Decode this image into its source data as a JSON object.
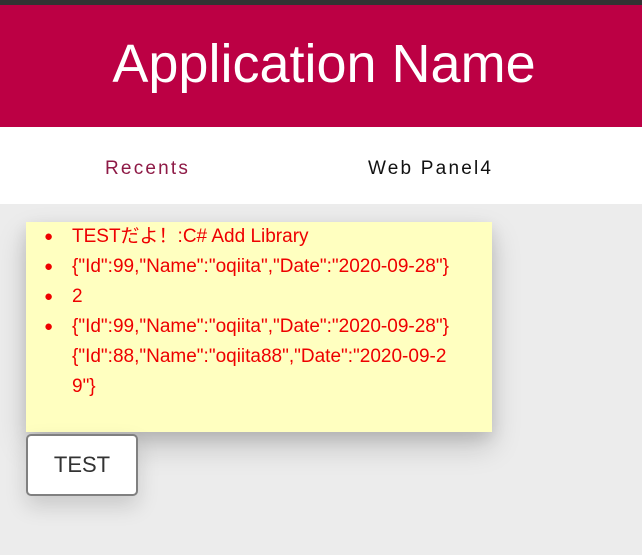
{
  "app": {
    "title": "Application Name"
  },
  "nav": {
    "tabs": [
      {
        "label": "Recents"
      },
      {
        "label": "Web Panel4"
      }
    ]
  },
  "panel": {
    "items": [
      "TESTだよ！:C# Add Library",
      "{\"Id\":99,\"Name\":\"oqiita\",\"Date\":\"2020-09-28\"}",
      "2",
      "{\"Id\":99,\"Name\":\"oqiita\",\"Date\":\"2020-09-28\"}{\"Id\":88,\"Name\":\"oqiita88\",\"Date\":\"2020-09-29\"}"
    ]
  },
  "actions": {
    "test_label": "TEST"
  },
  "colors": {
    "header_bg": "#bc0044",
    "active_tab": "#8e1a46",
    "panel_bg": "#ffffc0",
    "panel_text": "#ee0000",
    "page_bg": "#ececec"
  }
}
